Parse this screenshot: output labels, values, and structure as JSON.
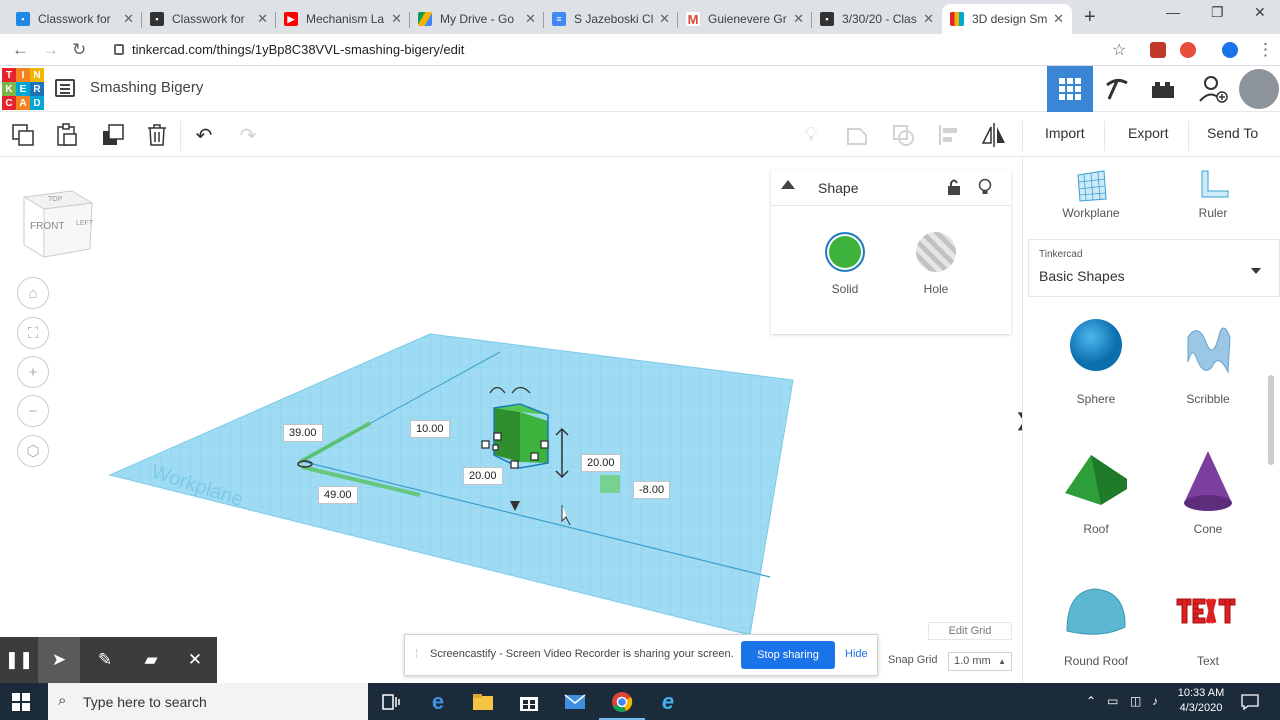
{
  "browser": {
    "tabs": [
      {
        "title": "Classwork for",
        "icon": "classroom-icon",
        "color": "#1e88e5"
      },
      {
        "title": "Classwork for",
        "icon": "classroom-icon",
        "color": "#333333"
      },
      {
        "title": "Mechanism La",
        "icon": "youtube-icon",
        "color": "#ff0000"
      },
      {
        "title": "My Drive - Go",
        "icon": "drive-icon",
        "color": "#0f9d58"
      },
      {
        "title": "S Jazeboski Cl",
        "icon": "docs-icon",
        "color": "#4285f4"
      },
      {
        "title": "Guienevere Gr",
        "icon": "gmail-icon",
        "color": "#db4437"
      },
      {
        "title": "3/30/20 - Clas",
        "icon": "classroom-icon",
        "color": "#333333"
      },
      {
        "title": "3D design Sm",
        "icon": "tinkercad-icon",
        "color": "#f4b400",
        "active": true
      }
    ],
    "url": "tinkercad.com/things/1yBp8C38VVL-smashing-bigery/edit"
  },
  "app": {
    "logo_letters": [
      "T",
      "I",
      "N",
      "K",
      "E",
      "R",
      "C",
      "A",
      "D"
    ],
    "logo_colors": [
      "#e5232d",
      "#f58220",
      "#f2b600",
      "#7ab648",
      "#00a6d6",
      "#1e72b8",
      "#e5232d",
      "#f58220",
      "#00a6d6"
    ],
    "design_name": "Smashing Bigery"
  },
  "toolbar": {
    "import_label": "Import",
    "export_label": "Export",
    "send_to_label": "Send To"
  },
  "shape_panel": {
    "title": "Shape",
    "solid_label": "Solid",
    "hole_label": "Hole",
    "solid_color": "#3db33d"
  },
  "right_panel": {
    "workplane_label": "Workplane",
    "ruler_label": "Ruler",
    "library_category": "Tinkercad",
    "library_name": "Basic Shapes",
    "shapes": [
      {
        "name": "Sphere",
        "color": "#1a8ecf"
      },
      {
        "name": "Scribble",
        "color": "#9cc6e6"
      },
      {
        "name": "Roof",
        "color": "#2e9e3a"
      },
      {
        "name": "Cone",
        "color": "#7b3fa0"
      },
      {
        "name": "Round Roof",
        "color": "#5bb8d0"
      },
      {
        "name": "Text",
        "color": "#e02020"
      }
    ]
  },
  "viewcube": {
    "front_label": "FRONT",
    "top_label": "TOP",
    "right_label": "LEFT"
  },
  "workplane_text": "Workplane",
  "dimensions": {
    "d1": "39.00",
    "d2": "10.00",
    "d3": "20.00",
    "d4": "20.00",
    "d5": "-8.00",
    "d6": "49.00"
  },
  "bottom": {
    "edit_grid_label": "Edit Grid",
    "snap_grid_label": "Snap Grid",
    "snap_grid_value": "1.0 mm"
  },
  "share_bar": {
    "message": "Screencastify - Screen Video Recorder is sharing your screen.",
    "stop_label": "Stop sharing",
    "hide_label": "Hide"
  },
  "taskbar": {
    "search_placeholder": "Type here to search",
    "time": "10:33 AM",
    "date": "4/3/2020"
  }
}
